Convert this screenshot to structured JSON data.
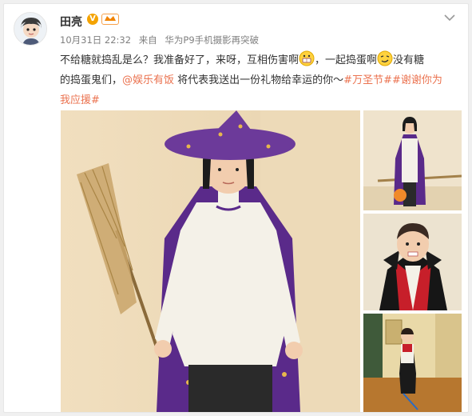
{
  "post": {
    "author": "田亮",
    "verified_badge": "V",
    "level_icon": "level-badge-icon",
    "date": "10月31日 22:32",
    "source_prefix": "来自",
    "source": "华为P9手机摄影再突破",
    "text_line1_a": "不给糖就捣乱是么？我准备好了，来呀，互相伤害啊",
    "text_line1_b": "，一起捣蛋啊",
    "text_line1_c": "没有糖",
    "text_line2_a": "的捣蛋鬼们，",
    "mention": "@娱乐有饭",
    "text_line2_b": " 将代表我送出一份礼物给幸运的你～",
    "hashtag1": "#万圣节#",
    "hashtag2": "#谢谢你为我应援#",
    "emoji1": "grin-emoji-icon",
    "emoji2": "sly-emoji-icon",
    "more_icon": "chevron-down-icon"
  },
  "colors": {
    "link": "#eb7350",
    "text": "#333333",
    "meta": "#808080",
    "badge": "#f4a300"
  }
}
